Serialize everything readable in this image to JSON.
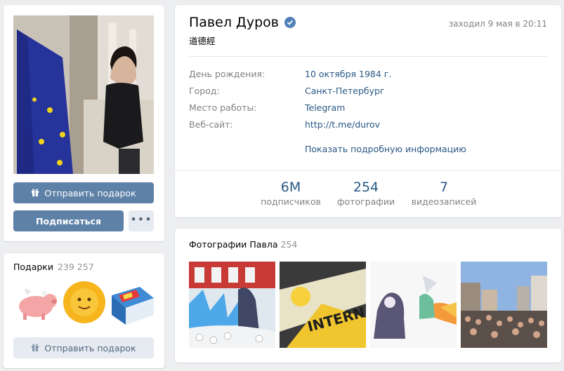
{
  "left": {
    "send_gift_label": "Отправить подарок",
    "subscribe_label": "Подписаться",
    "more_label": "•••"
  },
  "gifts": {
    "title": "Подарки",
    "count": "239 257",
    "send_gift_label": "Отправить подарок"
  },
  "profile": {
    "name": "Павел Дуров",
    "status": "道德經",
    "last_seen": "заходил 9 мая в 20:11",
    "info": [
      {
        "label": "День рождения:",
        "value": "10 октября 1984 г."
      },
      {
        "label": "Город:",
        "value": "Санкт-Петербург"
      },
      {
        "label": "Место работы:",
        "value": "Telegram"
      },
      {
        "label": "Веб-сайт:",
        "value": "http://t.me/durov"
      }
    ],
    "show_more": "Показать подробную информацию",
    "stats": [
      {
        "num": "6M",
        "label": "подписчиков"
      },
      {
        "num": "254",
        "label": "фотографии"
      },
      {
        "num": "7",
        "label": "видеозаписей"
      }
    ]
  },
  "photos": {
    "title": "Фотографии Павла",
    "count": "254"
  },
  "colors": {
    "accent": "#5181b8",
    "link": "#2a5885",
    "button": "#5e81a8",
    "background": "#edeef0"
  }
}
